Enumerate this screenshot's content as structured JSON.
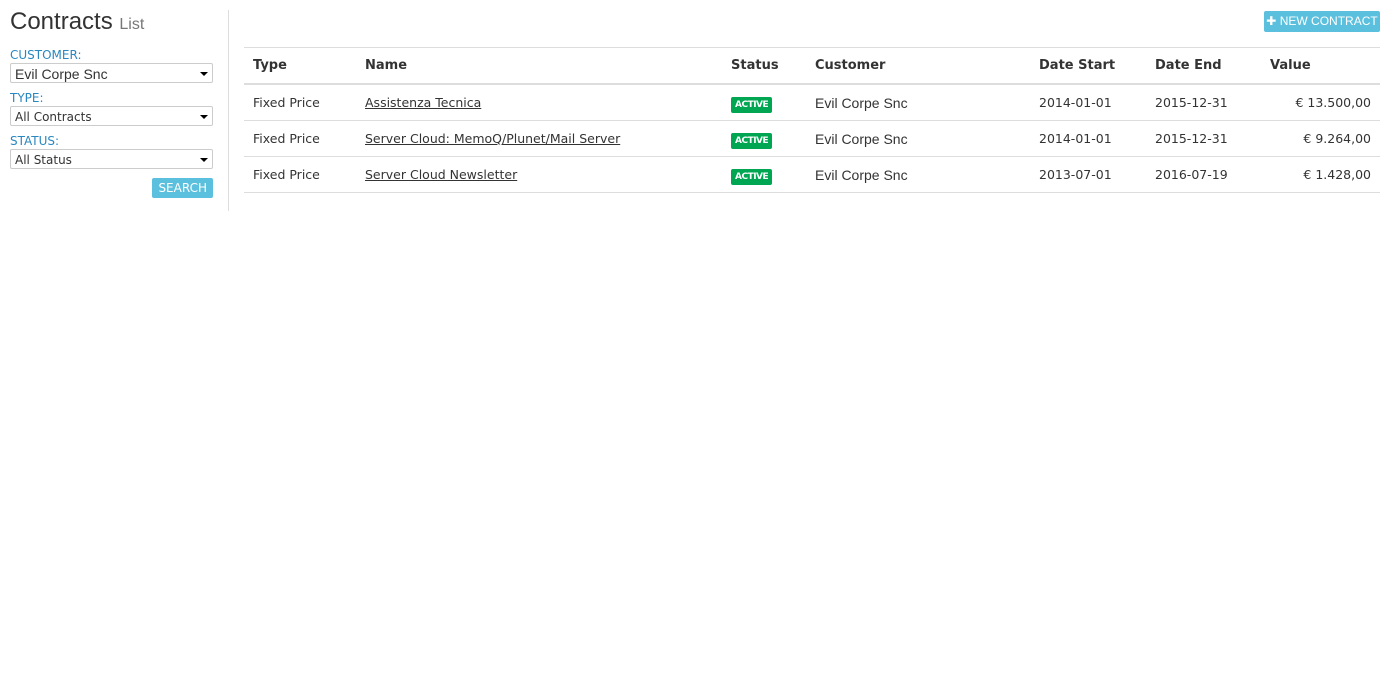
{
  "header": {
    "title": "Contracts",
    "subtitle": "List",
    "new_button": "NEW CONTRACT",
    "new_icon": "plus-icon"
  },
  "filters": {
    "customer_label": "CUSTOMER:",
    "customer_value": "Evil Corpe Snc",
    "type_label": "TYPE:",
    "type_value": "All Contracts",
    "status_label": "STATUS:",
    "status_value": "All Status",
    "search_button": "SEARCH"
  },
  "table": {
    "columns": [
      "Type",
      "Name",
      "Status",
      "Customer",
      "Date Start",
      "Date End",
      "Value"
    ],
    "rows": [
      {
        "type": "Fixed Price",
        "name": "Assistenza Tecnica",
        "status": "ACTIVE",
        "customer": "Evil Corpe Snc",
        "start": "2014-01-01",
        "end": "2015-12-31",
        "value": "€ 13.500,00"
      },
      {
        "type": "Fixed Price",
        "name": "Server Cloud: MemoQ/Plunet/Mail Server",
        "status": "ACTIVE",
        "customer": "Evil Corpe Snc",
        "start": "2014-01-01",
        "end": "2015-12-31",
        "value": "€ 9.264,00"
      },
      {
        "type": "Fixed Price",
        "name": "Server Cloud Newsletter",
        "status": "ACTIVE",
        "customer": "Evil Corpe Snc",
        "start": "2013-07-01",
        "end": "2016-07-19",
        "value": "€ 1.428,00"
      }
    ]
  },
  "colors": {
    "accent": "#5bc0de",
    "label": "#2a88c0",
    "active": "#00a651"
  }
}
